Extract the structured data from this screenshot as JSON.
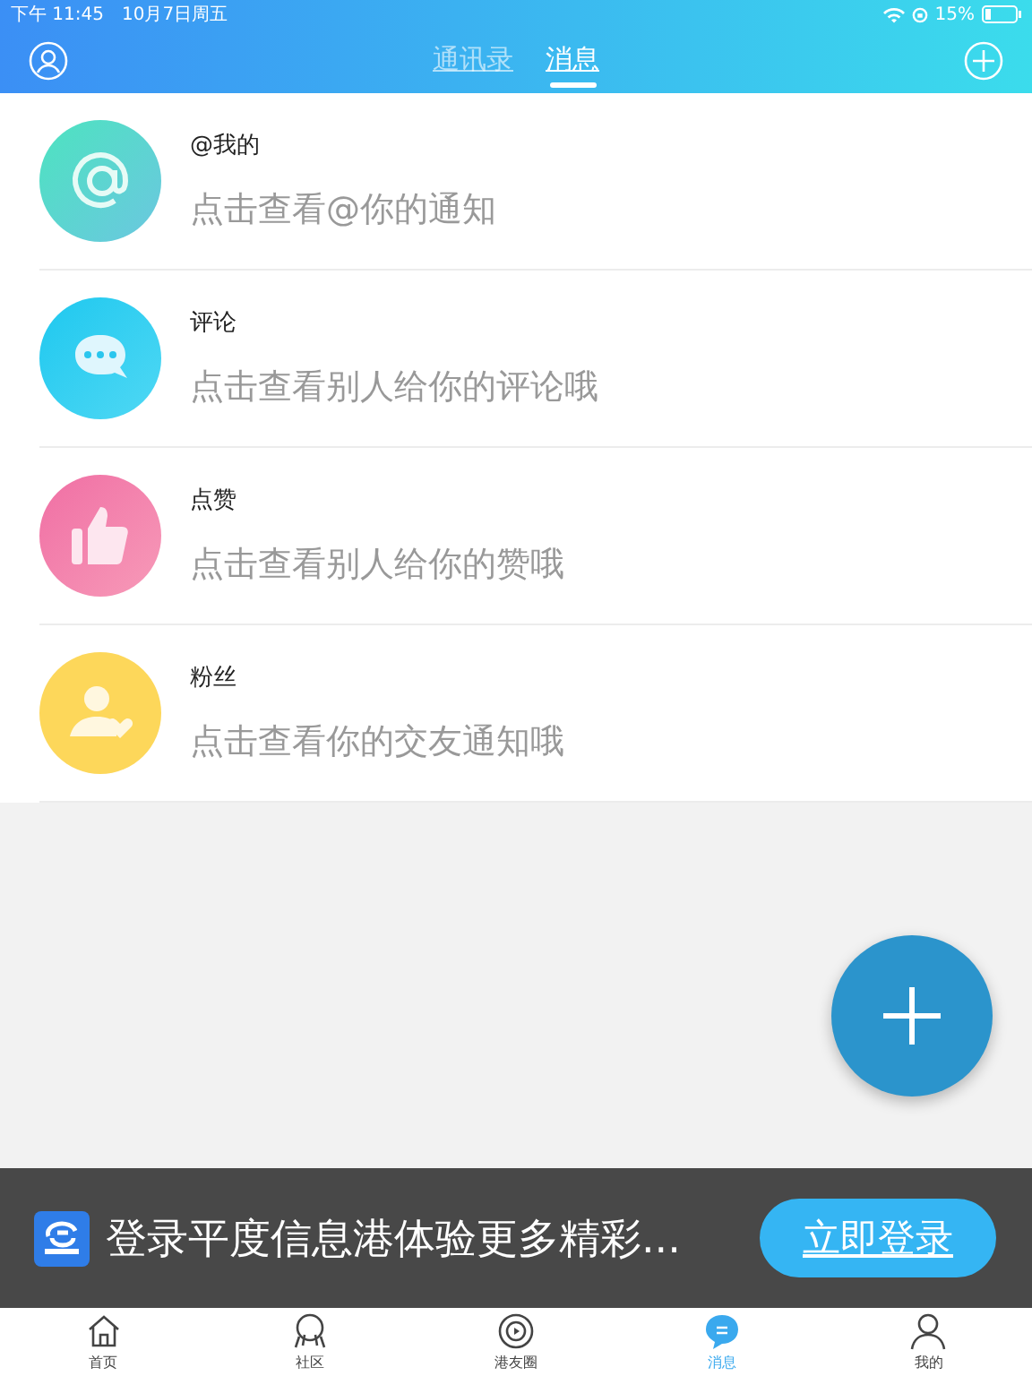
{
  "status_bar": {
    "time": "下午 11:45",
    "date": "10月7日周五",
    "battery": "15%"
  },
  "header": {
    "tabs": [
      {
        "label": "通讯录",
        "selected": false
      },
      {
        "label": "消息",
        "selected": true
      }
    ]
  },
  "messages": [
    {
      "kind": "at",
      "title": "@我的",
      "subtitle": "点击查看@你的通知"
    },
    {
      "kind": "comment",
      "title": "评论",
      "subtitle": "点击查看别人给你的评论哦"
    },
    {
      "kind": "like",
      "title": "点赞",
      "subtitle": "点击查看别人给你的赞哦"
    },
    {
      "kind": "fans",
      "title": "粉丝",
      "subtitle": "点击查看你的交友通知哦"
    }
  ],
  "login_banner": {
    "text": "登录平度信息港体验更多精彩...",
    "button": "立即登录"
  },
  "tab_bar": [
    {
      "kind": "home",
      "label": "首页",
      "selected": false
    },
    {
      "kind": "community",
      "label": "社区",
      "selected": false
    },
    {
      "kind": "circle",
      "label": "港友圈",
      "selected": false
    },
    {
      "kind": "message",
      "label": "消息",
      "selected": true
    },
    {
      "kind": "me",
      "label": "我的",
      "selected": false
    }
  ]
}
